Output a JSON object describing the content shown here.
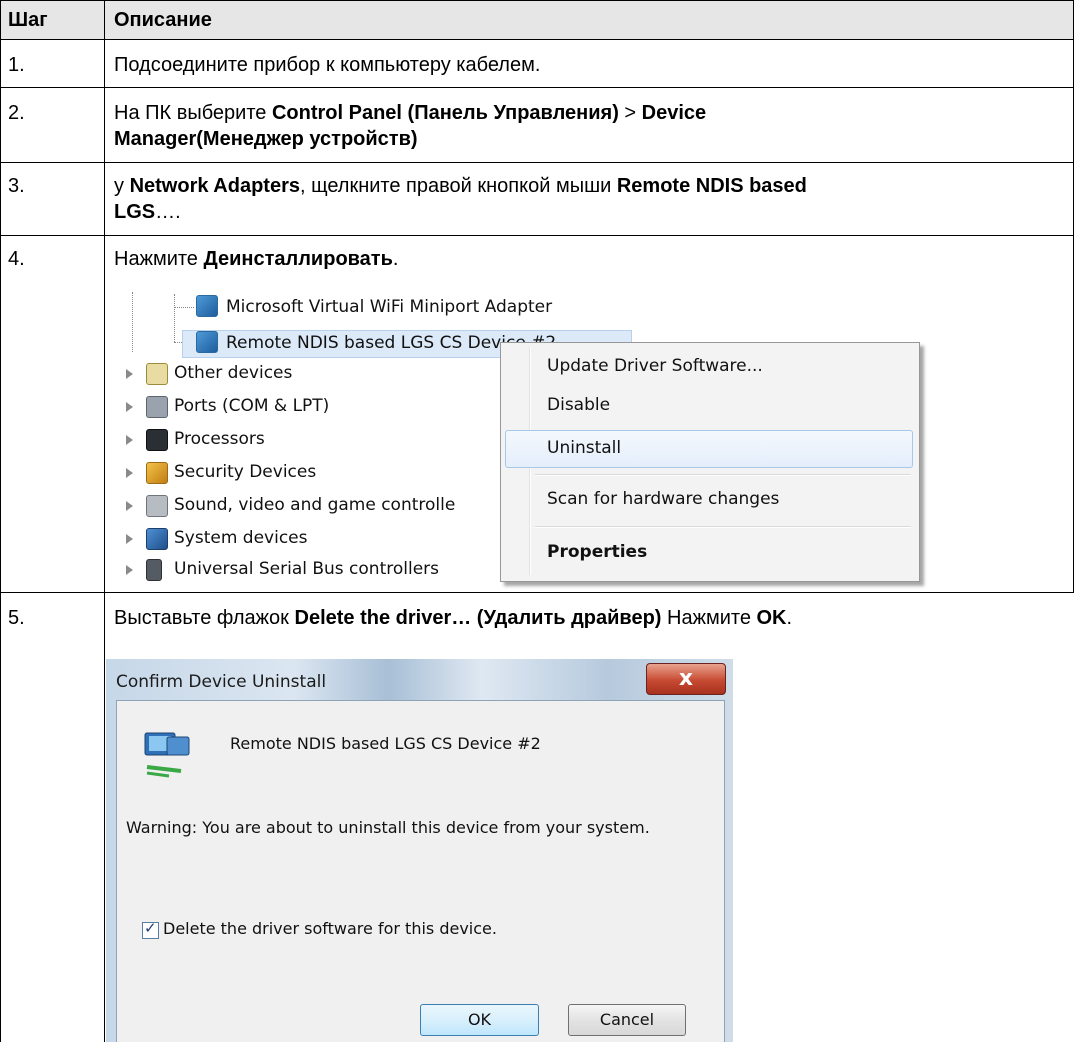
{
  "table": {
    "headers": {
      "step": "Шаг",
      "description": "Описание"
    },
    "steps": [
      {
        "num": "1.",
        "text": "Подсоедините прибор к компьютеру кабелем."
      },
      {
        "num": "2.",
        "t1": "На ПК выберите ",
        "b1": "Control Panel (Панель Управления)",
        "t2": " > ",
        "b2": "Device",
        "b3": "Manager(Менеджер устройств)"
      },
      {
        "num": "3.",
        "t1": "у ",
        "b1": "Network Adapters",
        "t2": ", щелкните правой кнопкой мыши ",
        "b2": "Remote NDIS based",
        "b3": "LGS",
        "t3": "…."
      },
      {
        "num": "4.",
        "t1": "Нажмите ",
        "b1": "Деинсталлировать",
        "t2": "."
      },
      {
        "num": "5.",
        "t1": "Выставьте флажок ",
        "b1": "Delete the driver… (Удалить драйвер)",
        "t2": " Нажмите ",
        "b2": "OK",
        "t3": "."
      }
    ]
  },
  "device_manager": {
    "tree": [
      "Microsoft Virtual WiFi Miniport Adapter",
      "Remote NDIS based LGS CS Device #2",
      "Other devices",
      "Ports (COM & LPT)",
      "Processors",
      "Security Devices",
      "Sound, video and game controlle",
      "System devices",
      "Universal Serial Bus controllers"
    ],
    "context_menu": {
      "items": [
        "Update Driver Software...",
        "Disable",
        "Uninstall",
        "Scan for hardware changes",
        "Properties"
      ]
    }
  },
  "dialog": {
    "title": "Confirm Device Uninstall",
    "close": "x",
    "device": "Remote NDIS based LGS CS Device #2",
    "warning": "Warning: You are about to uninstall this device from your system.",
    "checkbox_label": "Delete the driver software for this device.",
    "checked": true,
    "ok": "OK",
    "cancel": "Cancel"
  },
  "colors": {
    "header_bg": "#e6e6e6",
    "selection": "#dbe9f8",
    "close_button": "#c74a32"
  }
}
